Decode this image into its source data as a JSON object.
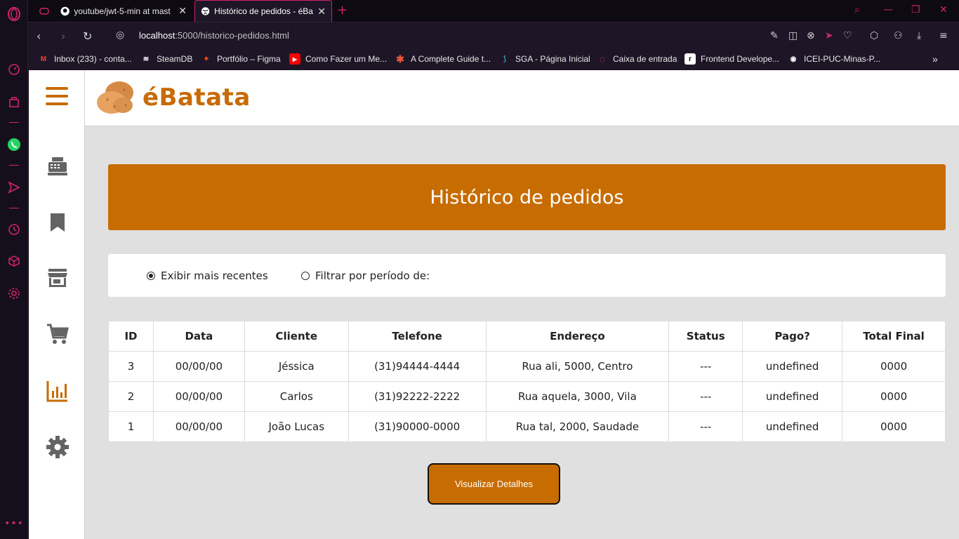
{
  "browser": {
    "tabs": [
      {
        "title": "youtube/jwt-5-min at mast"
      },
      {
        "title": "Histórico de pedidos - éBat"
      }
    ],
    "url_host": "localhost",
    "url_path": ":5000/historico-pedidos.html",
    "bookmarks": [
      {
        "label": "Inbox (233) - conta...",
        "icon": "gmail-icon"
      },
      {
        "label": "SteamDB",
        "icon": "steamdb-icon"
      },
      {
        "label": "Portfólio – Figma",
        "icon": "figma-icon"
      },
      {
        "label": "Como Fazer um Me...",
        "icon": "youtube-icon"
      },
      {
        "label": "A Complete Guide t...",
        "icon": "asterisk-icon"
      },
      {
        "label": "SGA - Página Inicial",
        "icon": "sga-icon"
      },
      {
        "label": "Caixa de entrada",
        "icon": "mail-ring-icon"
      },
      {
        "label": "Frontend Develope...",
        "icon": "frontend-icon"
      },
      {
        "label": "ICEI-PUC-Minas-P...",
        "icon": "github-icon"
      }
    ],
    "accent_color": "#d0246a"
  },
  "app": {
    "brand_name": "éBatata",
    "brand_color": "#c76b06",
    "page_title": "Histórico de pedidos",
    "filters": {
      "option_recent": "Exibir mais recentes",
      "option_period": "Filtrar por período de:",
      "selected": "recent"
    },
    "table": {
      "headers": [
        "ID",
        "Data",
        "Cliente",
        "Telefone",
        "Endereço",
        "Status",
        "Pago?",
        "Total Final"
      ],
      "rows": [
        [
          "3",
          "00/00/00",
          "Jéssica",
          "(31)94444-4444",
          "Rua ali, 5000, Centro",
          "---",
          "undefined",
          "0000"
        ],
        [
          "2",
          "00/00/00",
          "Carlos",
          "(31)92222-2222",
          "Rua aquela, 3000, Vila",
          "---",
          "undefined",
          "0000"
        ],
        [
          "1",
          "00/00/00",
          "João Lucas",
          "(31)90000-0000",
          "Rua tal, 2000, Saudade",
          "---",
          "undefined",
          "0000"
        ]
      ]
    },
    "details_button": "Visualizar Detalhes"
  }
}
